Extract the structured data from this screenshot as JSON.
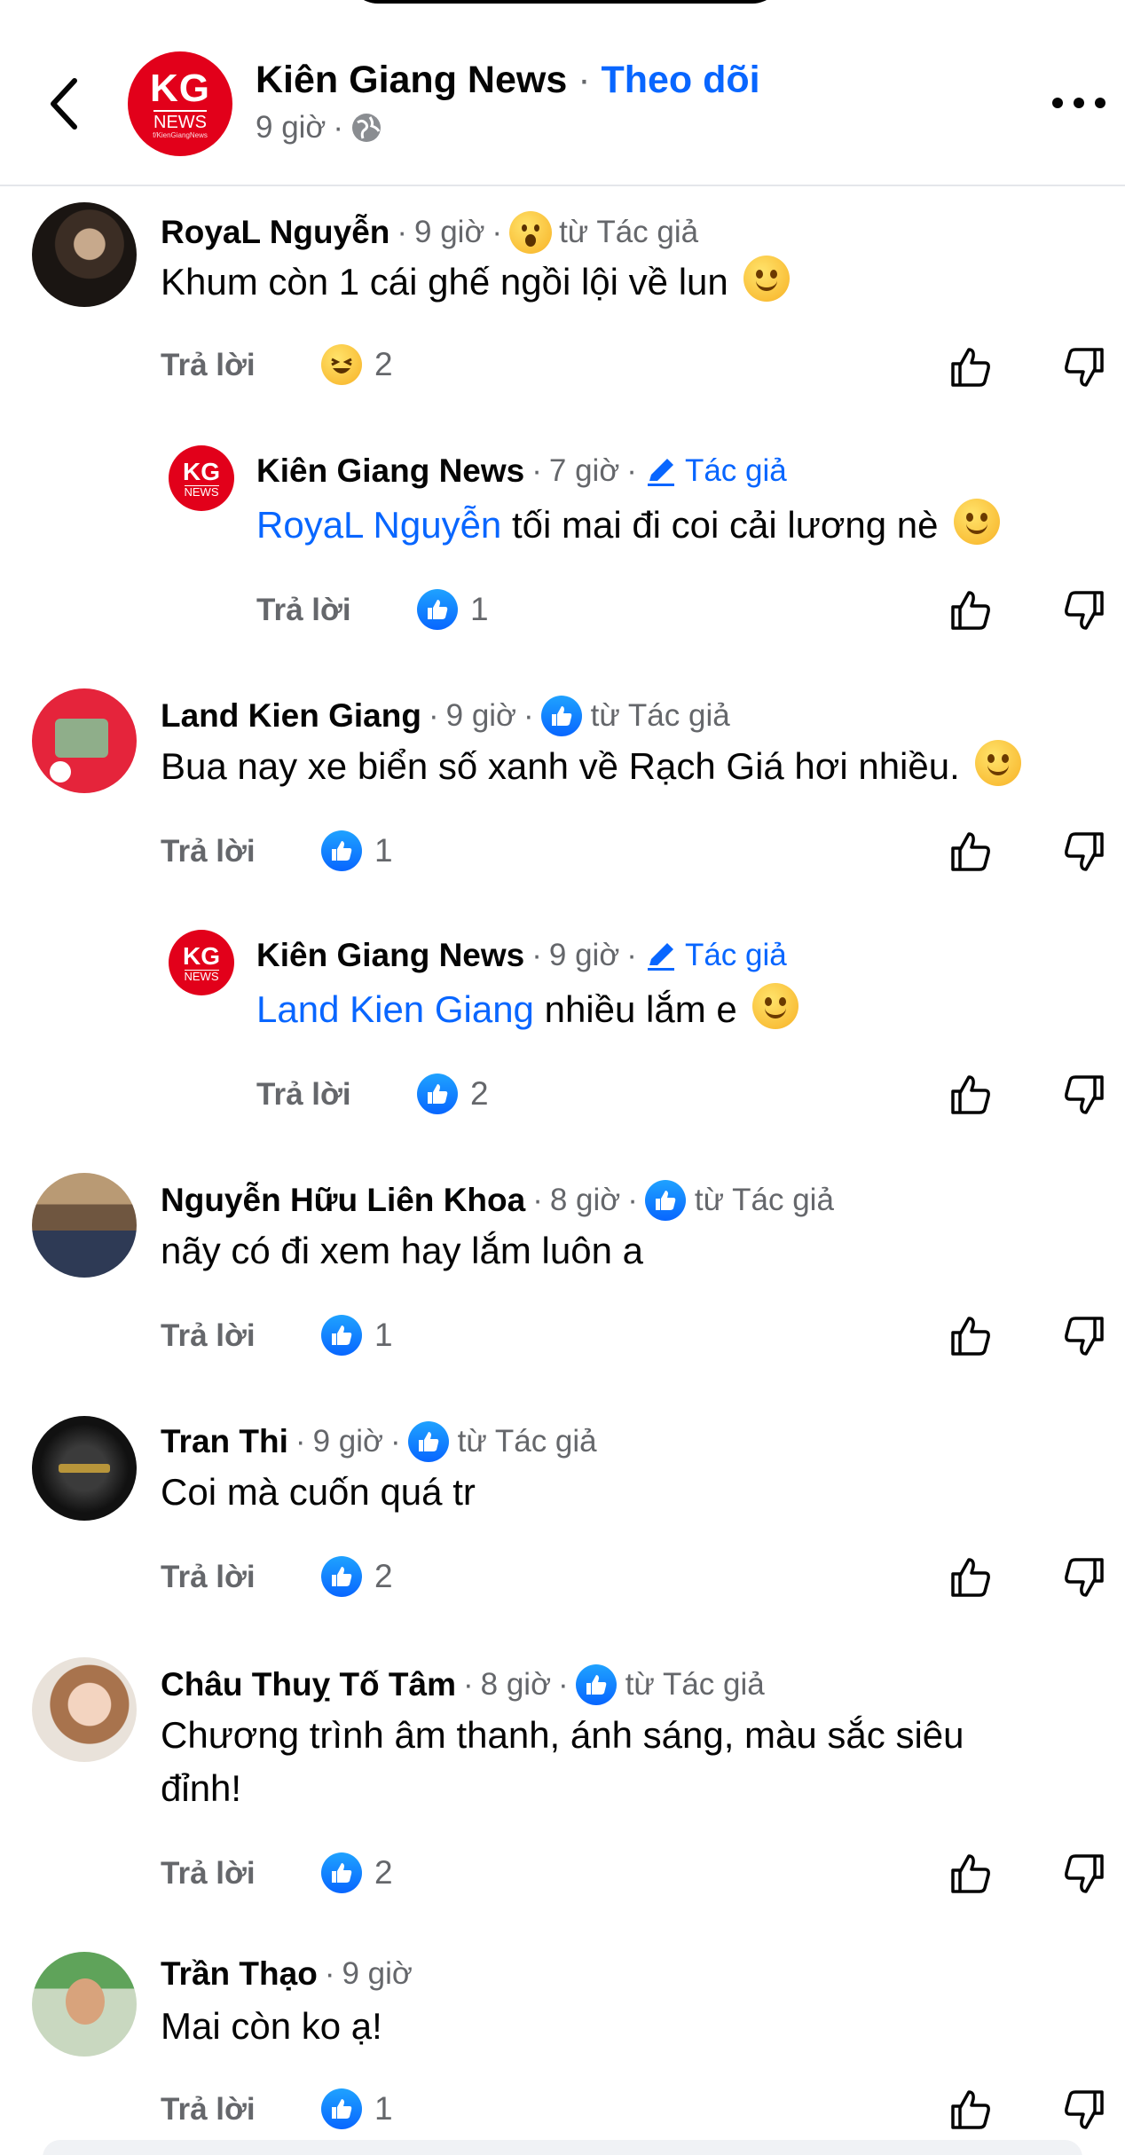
{
  "header": {
    "page_name": "Kiên Giang News",
    "separator": "·",
    "follow_label": "Theo dõi",
    "time": "9 giờ",
    "meta_dot": "·",
    "avatar_logo_top": "KG",
    "avatar_logo_bottom": "NEWS",
    "avatar_logo_caption": "f/KienGiangNews"
  },
  "comments": [
    {
      "name": "RoyaL Nguyễn",
      "time": "9 giờ",
      "badge": "từ Tác giả",
      "badge_icon": "surprised-emoji-icon",
      "text": "Khum còn 1 cái ghế ngồi lội về lun",
      "text_emoji": "😆",
      "reply_label": "Trả lời",
      "reaction_icon": "haha-emoji-icon",
      "reaction_count": "2"
    },
    {
      "name": "Kiên Giang News",
      "time": "7 giờ",
      "badge": "Tác giả",
      "mention": "RoyaL Nguyễn",
      "text": " tối mai đi coi cải lương nè",
      "text_emoji": "😊",
      "reply_label": "Trả lời",
      "reaction_count": "1"
    },
    {
      "name": "Land Kien Giang",
      "time": "9 giờ",
      "badge": "từ Tác giả",
      "text": "Bua nay xe biển số xanh về Rạch Giá hơi nhiều.",
      "text_emoji": "☺️",
      "reply_label": "Trả lời",
      "reaction_count": "1"
    },
    {
      "name": "Kiên Giang News",
      "time": "9 giờ",
      "badge": "Tác giả",
      "mention": "Land Kien Giang",
      "text": " nhiều lắm e",
      "text_emoji": "😊",
      "reply_label": "Trả lời",
      "reaction_count": "2"
    },
    {
      "name": "Nguyễn Hữu Liên Khoa",
      "time": "8 giờ",
      "badge": "từ Tác giả",
      "text": "nãy có đi xem hay lắm luôn a",
      "reply_label": "Trả lời",
      "reaction_count": "1"
    },
    {
      "name": "Tran Thi",
      "time": "9 giờ",
      "badge": "từ Tác giả",
      "text": "Coi mà cuốn quá tr",
      "reply_label": "Trả lời",
      "reaction_count": "2"
    },
    {
      "name": "Châu Thuỵ Tố Tâm",
      "time": "8 giờ",
      "badge": "từ Tác giả",
      "text": "Chương trình âm thanh, ánh sáng, màu sắc siêu đỉnh!",
      "reply_label": "Trả lời",
      "reaction_count": "2"
    },
    {
      "name": "Trần Thạo",
      "time": "9 giờ",
      "text": "Mai còn ko ạ!",
      "reply_label": "Trả lời",
      "reaction_count": "1"
    }
  ],
  "colors": {
    "accent": "#0866ff",
    "muted": "#65676b",
    "brand_red": "#e2001a"
  }
}
